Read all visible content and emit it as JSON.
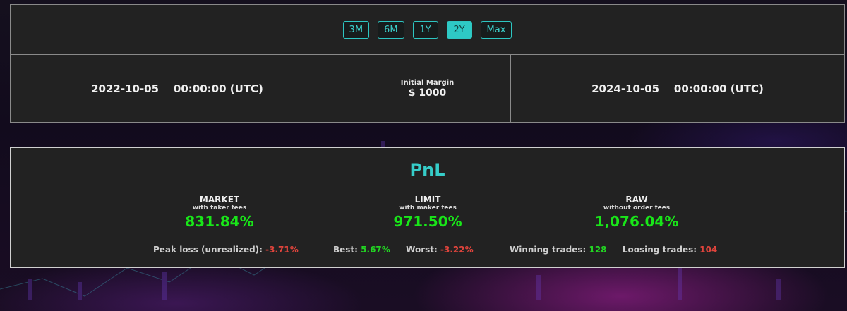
{
  "range_buttons": [
    {
      "label": "3M",
      "active": false
    },
    {
      "label": "6M",
      "active": false
    },
    {
      "label": "1Y",
      "active": false
    },
    {
      "label": "2Y",
      "active": true
    },
    {
      "label": "Max",
      "active": false
    }
  ],
  "dates": {
    "start": "2022-10-05    00:00:00 (UTC)",
    "end": "2024-10-05    00:00:00 (UTC)"
  },
  "initial_margin": {
    "label": "Initial Margin",
    "value": "$ 1000"
  },
  "pnl": {
    "title": "PnL",
    "market": {
      "name": "MARKET",
      "sub": "with taker fees",
      "value": "831.84%"
    },
    "limit": {
      "name": "LIMIT",
      "sub": "with maker fees",
      "value": "971.50%"
    },
    "raw": {
      "name": "RAW",
      "sub": "without order fees",
      "value": "1,076.04%"
    },
    "peak_loss_label": "Peak loss (unrealized):",
    "peak_loss_value": "-3.71%",
    "best_label": "Best:",
    "best_value": "5.67%",
    "worst_label": "Worst:",
    "worst_value": "-3.22%",
    "winning_label": "Winning trades:",
    "winning_value": "128",
    "loosing_label": "Loosing trades:",
    "loosing_value": "104"
  },
  "colors": {
    "accent": "#2ec9c5",
    "positive": "#19e619",
    "negative": "#e0443c",
    "panel": "#222222"
  }
}
